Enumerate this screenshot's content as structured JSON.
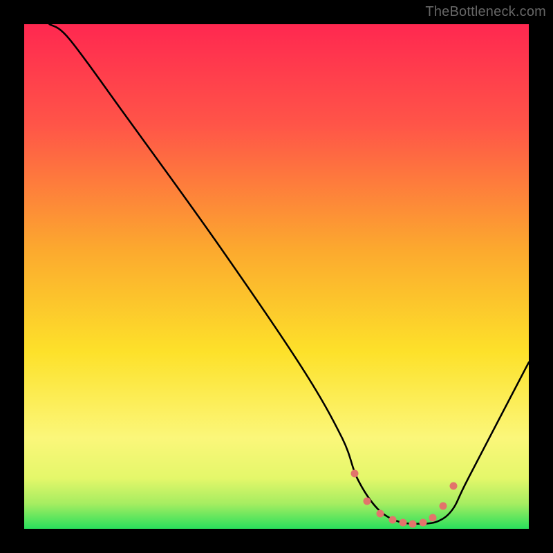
{
  "watermark": "TheBottleneck.com",
  "colors": {
    "dot": "#e2746b",
    "curve": "#000000",
    "frame": "#000000"
  },
  "chart_data": {
    "type": "line",
    "title": "",
    "xlabel": "",
    "ylabel": "",
    "xlim": [
      0,
      100
    ],
    "ylim": [
      0,
      100
    ],
    "grid": false,
    "gradient_stops": [
      {
        "pos": 0,
        "color": "#ff2850"
      },
      {
        "pos": 20,
        "color": "#ff5548"
      },
      {
        "pos": 45,
        "color": "#fcaa2e"
      },
      {
        "pos": 65,
        "color": "#fde12a"
      },
      {
        "pos": 82,
        "color": "#fbf77a"
      },
      {
        "pos": 90,
        "color": "#e4f76a"
      },
      {
        "pos": 95,
        "color": "#a6ed61"
      },
      {
        "pos": 100,
        "color": "#29e05c"
      }
    ],
    "series": [
      {
        "name": "bottleneck-curve",
        "x": [
          5,
          9,
          20,
          38,
          55,
          63,
          66,
          70,
          74,
          78,
          82,
          85,
          88,
          100
        ],
        "y": [
          100,
          97,
          82,
          57,
          32,
          18,
          10,
          4,
          1.5,
          1,
          1.5,
          4,
          10,
          33
        ]
      }
    ],
    "highlight_dots": {
      "name": "optimal-range",
      "x": [
        65.5,
        68,
        70.5,
        73,
        75,
        77,
        79,
        81,
        83,
        85
      ],
      "y": [
        11,
        5.5,
        3,
        1.8,
        1.2,
        1,
        1.3,
        2.2,
        4.5,
        8.5
      ]
    }
  }
}
